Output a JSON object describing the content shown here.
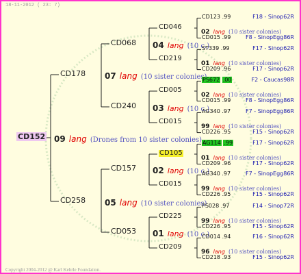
{
  "header": {
    "date": "18-11-2012 ( 23:  7)"
  },
  "footer": {
    "copyright": "Copyright 2004-2012 @ Karl Kehrle Foundation."
  },
  "lang_word": "lang",
  "root": {
    "label": "CD152",
    "prefix": "09",
    "note": "(Drones from 10 sister colonies)"
  },
  "level1": [
    {
      "label": "CD178",
      "prefix": "07",
      "note": "(10 sister colonies)"
    },
    {
      "label": "CD258",
      "prefix": "05",
      "note": "(10 sister colonies)"
    }
  ],
  "level2": [
    {
      "label": "CD068",
      "prefix": "04",
      "note": "(10 c.)"
    },
    {
      "label": "CD240",
      "prefix": "03",
      "note": "(10 c.)"
    },
    {
      "label": "CD157",
      "prefix": "02",
      "note": "(10 c.)"
    },
    {
      "label": "CD053",
      "prefix": "01",
      "note": "(10 c.)"
    }
  ],
  "level3": [
    {
      "label": "CD046",
      "highlight": ""
    },
    {
      "label": "CD219",
      "highlight": ""
    },
    {
      "label": "CD005",
      "highlight": ""
    },
    {
      "label": "CD015",
      "highlight": ""
    },
    {
      "label": "CD105",
      "highlight": "yellow"
    },
    {
      "label": "CD015",
      "highlight": ""
    },
    {
      "label": "CD225",
      "highlight": ""
    },
    {
      "label": "CD209",
      "highlight": ""
    }
  ],
  "level4": [
    {
      "top": {
        "id": "CD123",
        "value": ".99",
        "highlight": "",
        "desc": "F18 - Sinop62R"
      },
      "mid_prefix": "02",
      "mid_note": "(10 sister colonies)",
      "bottom": {
        "id": "CD015",
        "value": ".99",
        "desc": "F8 - SinopEgg86R"
      }
    },
    {
      "top": {
        "id": "ST339",
        "value": ".99",
        "highlight": "",
        "desc": "F17 - Sinop62R"
      },
      "mid_prefix": "01",
      "mid_note": "(10 sister colonies)",
      "bottom": {
        "id": "CD209",
        "value": ".96",
        "desc": "F17 - Sinop62R"
      }
    },
    {
      "top": {
        "id": "PS672",
        "value": ".00",
        "highlight": "green",
        "desc": "F2 - Caucas98R"
      },
      "mid_prefix": "02",
      "mid_note": "(10 sister colonies)",
      "bottom": {
        "id": "CD015",
        "value": ".99",
        "desc": "F8 - SinopEgg86R"
      }
    },
    {
      "top": {
        "id": "AG340",
        "value": ".97",
        "highlight": "",
        "desc": "F7 - SinopEgg86R"
      },
      "mid_prefix": "99",
      "mid_note": "(10 sister colonies)",
      "bottom": {
        "id": "CD226",
        "value": ".95",
        "desc": "F15 - Sinop62R"
      }
    },
    {
      "top": {
        "id": "AG114",
        "value": ".99",
        "highlight": "green",
        "desc": "F17 - Sinop62R"
      },
      "mid_prefix": "01",
      "mid_note": "(10 sister colonies)",
      "bottom": {
        "id": "CD209",
        "value": ".96",
        "desc": "F17 - Sinop62R"
      }
    },
    {
      "top": {
        "id": "AG340",
        "value": ".97",
        "highlight": "",
        "desc": "F7 - SinopEgg86R"
      },
      "mid_prefix": "99",
      "mid_note": "(10 sister colonies)",
      "bottom": {
        "id": "CD226",
        "value": ".95",
        "desc": "F15 - Sinop62R"
      }
    },
    {
      "top": {
        "id": "PS028",
        "value": ".97",
        "highlight": "",
        "desc": "F14 - Sinop72R"
      },
      "mid_prefix": "99",
      "mid_note": "(10 sister colonies)",
      "bottom": {
        "id": "CD226",
        "value": ".95",
        "desc": "F15 - Sinop62R"
      }
    },
    {
      "top": {
        "id": "CD014",
        "value": ".94",
        "highlight": "",
        "desc": "F16 - Sinop62R"
      },
      "mid_prefix": "96",
      "mid_note": "(10 sister colonies)",
      "bottom": {
        "id": "CD218",
        "value": ".93",
        "desc": "F15 - Sinop62R"
      }
    }
  ]
}
